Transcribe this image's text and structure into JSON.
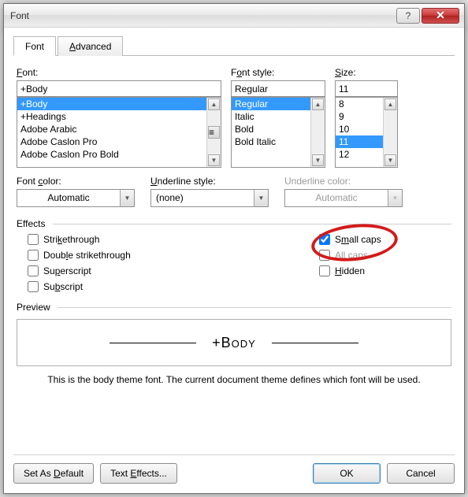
{
  "title": "Font",
  "tabs": {
    "font": "Font",
    "advanced": "Advanced"
  },
  "fontSection": {
    "label": "Font:",
    "value": "+Body",
    "items": [
      "+Body",
      "+Headings",
      "Adobe Arabic",
      "Adobe Caslon Pro",
      "Adobe Caslon Pro Bold"
    ],
    "selectedIndex": 0
  },
  "styleSection": {
    "label": "Font style:",
    "value": "Regular",
    "items": [
      "Regular",
      "Italic",
      "Bold",
      "Bold Italic"
    ],
    "selectedIndex": 0
  },
  "sizeSection": {
    "label": "Size:",
    "value": "11",
    "items": [
      "8",
      "9",
      "10",
      "11",
      "12"
    ],
    "selectedIndex": 3
  },
  "fontColor": {
    "label": "Font color:",
    "value": "Automatic"
  },
  "underlineStyle": {
    "label": "Underline style:",
    "value": "(none)"
  },
  "underlineColor": {
    "label": "Underline color:",
    "value": "Automatic"
  },
  "effectsLabel": "Effects",
  "effects": {
    "strikethrough": "Strikethrough",
    "doubleStrikethrough": "Double strikethrough",
    "superscript": "Superscript",
    "subscript": "Subscript",
    "smallCaps": "Small caps",
    "allCaps": "All caps",
    "hidden": "Hidden"
  },
  "previewLabel": "Preview",
  "previewText": "+Body",
  "note": "This is the body theme font. The current document theme defines which font will be used.",
  "buttons": {
    "setDefault": "Set As Default",
    "textEffects": "Text Effects...",
    "ok": "OK",
    "cancel": "Cancel"
  }
}
